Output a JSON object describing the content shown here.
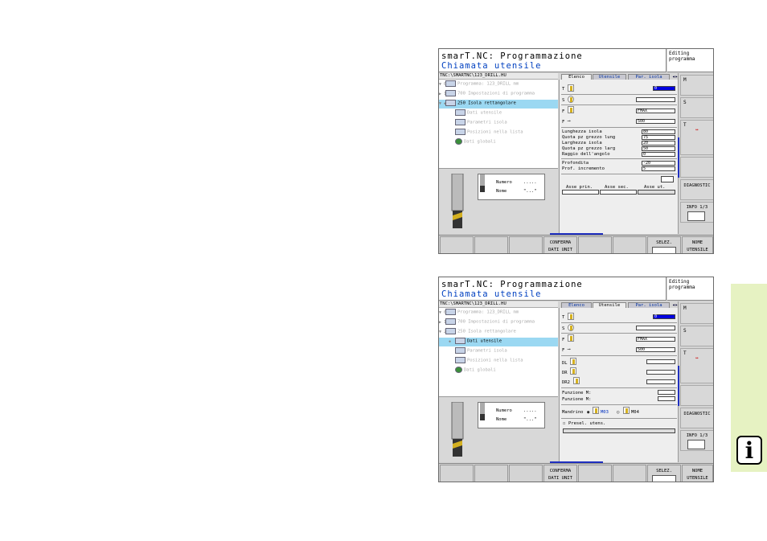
{
  "screens": [
    {
      "title": "smarT.NC: Programmazione",
      "subtitle": "Chiamata utensile",
      "mode": [
        "Editing",
        "programma"
      ],
      "path": "TNC:\\SMARTNC\\123_DRILL.HU",
      "tabs": [
        "Elenco",
        "Utensile",
        "Par. isola"
      ],
      "tree": [
        {
          "label": "Programma: 123_DRILL mm",
          "style": "dim"
        },
        {
          "label": "700 Impostazioni di programma",
          "style": "dim"
        },
        {
          "label": "250 Isola rettangolare",
          "style": "sel"
        },
        {
          "label": "Dati utensile",
          "style": "dim"
        },
        {
          "label": "Parametri isola",
          "style": "dim"
        },
        {
          "label": "Posizioni nella lista",
          "style": "dim"
        },
        {
          "label": "Dati globali",
          "style": "dim"
        }
      ],
      "fields": {
        "T": "0",
        "S": "",
        "F": "FMAX",
        "F2": "500",
        "rows": [
          {
            "label": "Lunghezza isola",
            "value": "80"
          },
          {
            "label": "Quota pz grezzo lung",
            "value": "75"
          },
          {
            "label": "Larghezza isola",
            "value": "20"
          },
          {
            "label": "Quota pz grezzo larg",
            "value": "50"
          },
          {
            "label": "Raggio dell'angolo",
            "value": "0"
          }
        ],
        "rows2": [
          {
            "label": "Profondita",
            "value": "-20"
          },
          {
            "label": "Prof. incremento",
            "value": "5"
          }
        ]
      },
      "axes": [
        "Asse prin.",
        "Asse sec.",
        "Asse ut."
      ]
    },
    {
      "title": "smarT.NC: Programmazione",
      "subtitle": "Chiamata utensile",
      "mode": [
        "Editing",
        "programma"
      ],
      "path": "TNC:\\SMARTNC\\123_DRILL.HU",
      "tabs": [
        "Elenco",
        "Utensile",
        "Par. isola"
      ],
      "tree": [
        {
          "label": "Programma: 123_DRILL mm",
          "style": "dim"
        },
        {
          "label": "700 Impostazioni di programma",
          "style": "dim"
        },
        {
          "label": "250 Isola rettangolare",
          "style": "dim"
        },
        {
          "label": "Dati utensile",
          "style": "sel"
        },
        {
          "label": "Parametri isola",
          "style": "dim"
        },
        {
          "label": "Posizioni nella lista",
          "style": "dim"
        },
        {
          "label": "Dati globali",
          "style": "dim"
        }
      ],
      "fields": {
        "T": "0",
        "S": "",
        "F": "FMAX",
        "F2": "500",
        "DL": "DL",
        "DR": "DR",
        "DR2": "DR2",
        "funz1": "Funzione M:",
        "funz2": "Funzione M:",
        "mandrino": "Mandrino",
        "m03": "M03",
        "m04": "M04",
        "presel": "Presel. utens."
      }
    }
  ],
  "tool_info": {
    "numero": "Numero",
    "numero_val": ".....",
    "nome": "Nome",
    "nome_val": "\"...\""
  },
  "side": {
    "diag": "DIAGNOSTIC",
    "info": "INFO 1/3"
  },
  "softkeys": {
    "confirm1": "CONFERMA",
    "confirm2": "DATI UNIT",
    "selez": "SELEZ.",
    "nome1": "NOME",
    "nome2": "UTENSILE"
  },
  "info_icon": "i"
}
